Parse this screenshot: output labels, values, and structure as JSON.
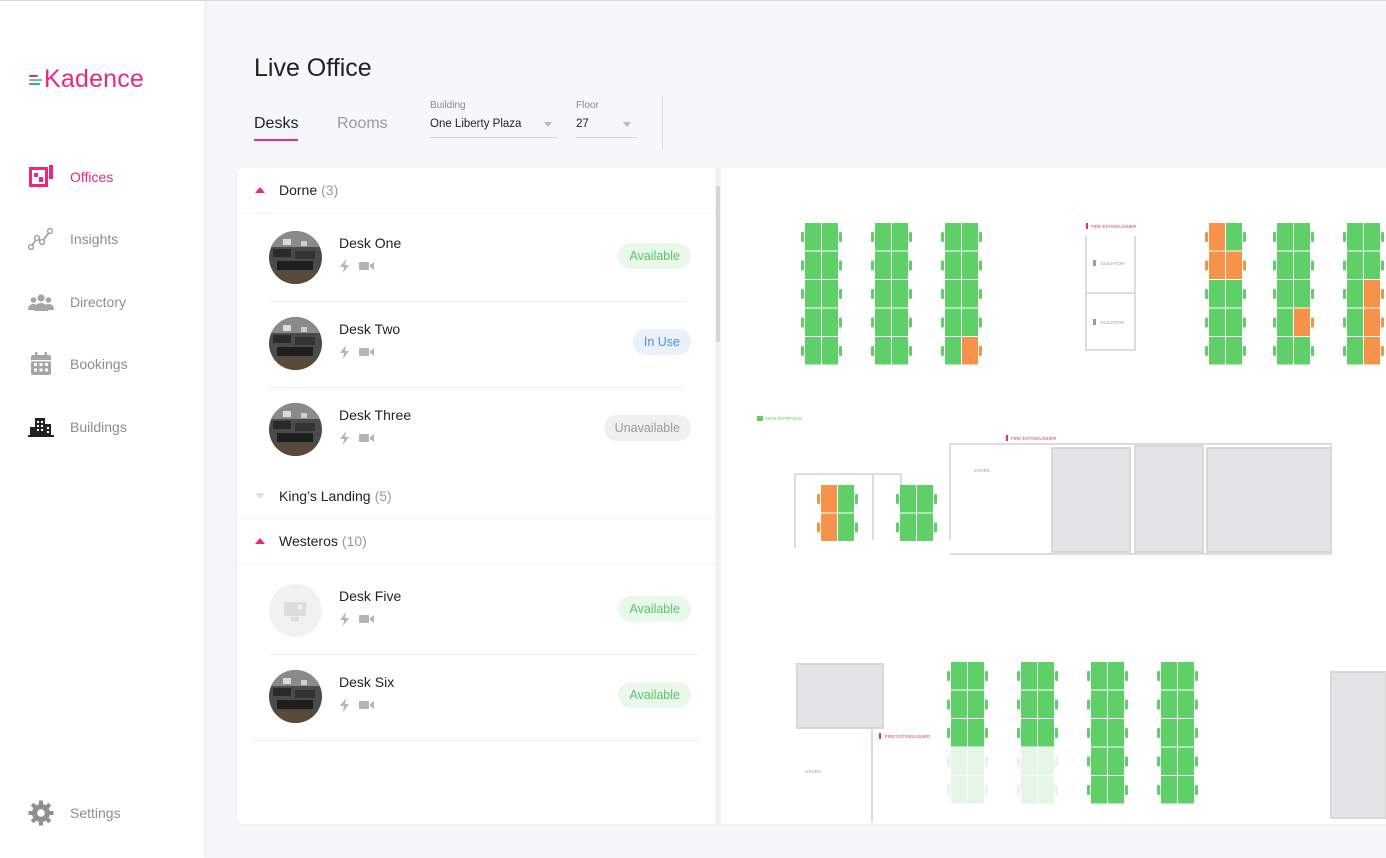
{
  "brand": {
    "name": "Kadence",
    "color": "#e8297d"
  },
  "sidebar": {
    "items": [
      {
        "label": "Offices",
        "icon": "floorplan-icon",
        "active": true
      },
      {
        "label": "Insights",
        "icon": "insights-icon",
        "active": false
      },
      {
        "label": "Directory",
        "icon": "people-icon",
        "active": false
      },
      {
        "label": "Bookings",
        "icon": "calendar-icon",
        "active": false
      },
      {
        "label": "Buildings",
        "icon": "building-icon",
        "active": false
      }
    ],
    "settings": {
      "label": "Settings",
      "icon": "gear-icon"
    }
  },
  "page": {
    "title": "Live Office"
  },
  "tabs": [
    {
      "label": "Desks",
      "active": true
    },
    {
      "label": "Rooms",
      "active": false
    }
  ],
  "filters": {
    "building": {
      "label": "Building",
      "value": "One Liberty Plaza"
    },
    "floor": {
      "label": "Floor",
      "value": "27"
    }
  },
  "groups": [
    {
      "name": "Dorne",
      "count": "(3)",
      "expanded": true
    },
    {
      "name": "King’s Landing",
      "count": "(5)",
      "expanded": false
    },
    {
      "name": "Westeros",
      "count": "(10)",
      "expanded": true
    }
  ],
  "desks": [
    {
      "name": "Desk One",
      "status": "Available"
    },
    {
      "name": "Desk Two",
      "status": "In Use"
    },
    {
      "name": "Desk Three",
      "status": "Unavailable"
    },
    {
      "name": "Desk Five",
      "status": "Available"
    },
    {
      "name": "Desk Six",
      "status": "Available"
    }
  ],
  "map": {
    "labels": {
      "fire_extinguisher": "FIRE EXTINGUISHER",
      "elevator": "ELEVATOR",
      "main_entrance": "MAIN ENTRANCE",
      "stairs": "STAIRS"
    },
    "colors": {
      "available": "#5fd068",
      "in_use": "#f7924a",
      "room": "#e4e4e6",
      "wall": "#dcdcdc"
    }
  }
}
